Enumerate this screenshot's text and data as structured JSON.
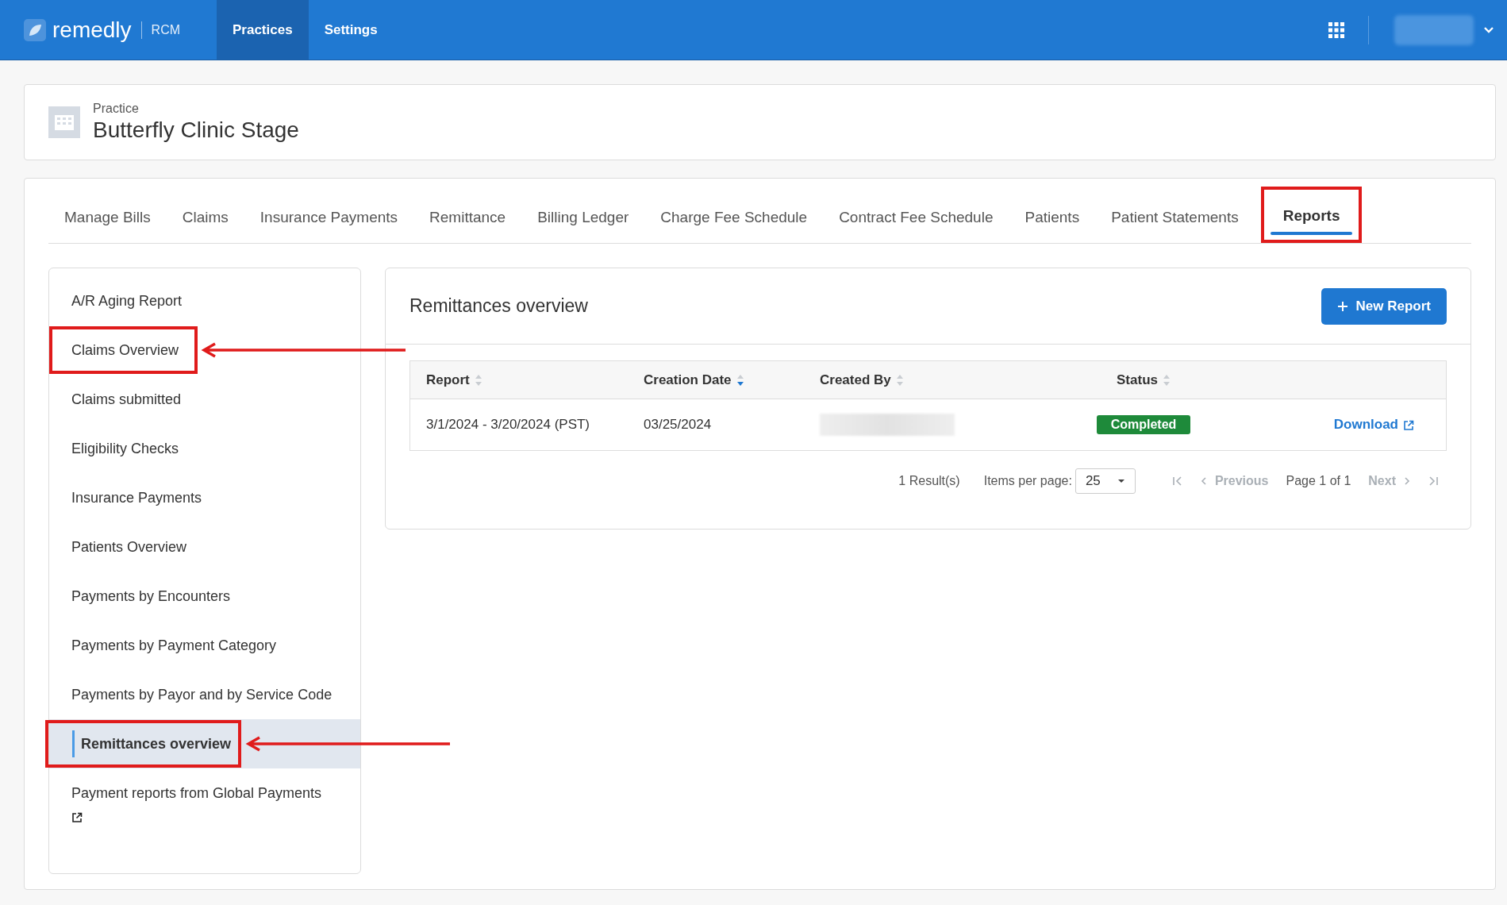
{
  "header": {
    "brand": "remedly",
    "product": "RCM",
    "nav": [
      {
        "label": "Practices",
        "selected": true
      },
      {
        "label": "Settings",
        "selected": false
      }
    ]
  },
  "practice": {
    "label": "Practice",
    "name": "Butterfly Clinic Stage"
  },
  "tabs": [
    {
      "label": "Manage Bills",
      "selected": false,
      "highlighted": false
    },
    {
      "label": "Claims",
      "selected": false,
      "highlighted": false
    },
    {
      "label": "Insurance Payments",
      "selected": false,
      "highlighted": false
    },
    {
      "label": "Remittance",
      "selected": false,
      "highlighted": false
    },
    {
      "label": "Billing Ledger",
      "selected": false,
      "highlighted": false
    },
    {
      "label": "Charge Fee Schedule",
      "selected": false,
      "highlighted": false
    },
    {
      "label": "Contract Fee Schedule",
      "selected": false,
      "highlighted": false
    },
    {
      "label": "Patients",
      "selected": false,
      "highlighted": false
    },
    {
      "label": "Patient Statements",
      "selected": false,
      "highlighted": false
    },
    {
      "label": "Reports",
      "selected": true,
      "highlighted": true
    }
  ],
  "sidebar": {
    "items": [
      {
        "label": "A/R Aging Report",
        "selected": false,
        "highlighted": false,
        "arrow": false,
        "external": false
      },
      {
        "label": "Claims Overview",
        "selected": false,
        "highlighted": true,
        "arrow": true,
        "external": false
      },
      {
        "label": "Claims submitted",
        "selected": false,
        "highlighted": false,
        "arrow": false,
        "external": false
      },
      {
        "label": "Eligibility Checks",
        "selected": false,
        "highlighted": false,
        "arrow": false,
        "external": false
      },
      {
        "label": "Insurance Payments",
        "selected": false,
        "highlighted": false,
        "arrow": false,
        "external": false
      },
      {
        "label": "Patients Overview",
        "selected": false,
        "highlighted": false,
        "arrow": false,
        "external": false
      },
      {
        "label": "Payments by Encounters",
        "selected": false,
        "highlighted": false,
        "arrow": false,
        "external": false
      },
      {
        "label": "Payments by Payment Category",
        "selected": false,
        "highlighted": false,
        "arrow": false,
        "external": false
      },
      {
        "label": "Payments by Payor and by Service Code",
        "selected": false,
        "highlighted": false,
        "arrow": false,
        "external": false
      },
      {
        "label": "Remittances overview",
        "selected": true,
        "highlighted": true,
        "arrow": true,
        "external": false
      },
      {
        "label": "Payment reports from Global Payments",
        "selected": false,
        "highlighted": false,
        "arrow": false,
        "external": true
      }
    ]
  },
  "panel": {
    "title": "Remittances overview",
    "new_button": "New Report",
    "table": {
      "columns": [
        {
          "label": "Report",
          "sorted": false
        },
        {
          "label": "Creation Date",
          "sorted": true
        },
        {
          "label": "Created By",
          "sorted": false
        },
        {
          "label": "Status",
          "sorted": false
        }
      ],
      "rows": [
        {
          "report": "3/1/2024 - 3/20/2024 (PST)",
          "creation_date": "03/25/2024",
          "status": "Completed",
          "action": "Download"
        }
      ]
    },
    "pagination": {
      "results": "1 Result(s)",
      "items_label": "Items per page:",
      "per_page": "25",
      "previous": "Previous",
      "page": "Page 1 of 1",
      "next": "Next",
      "previous_disabled": true,
      "next_disabled": true
    }
  }
}
